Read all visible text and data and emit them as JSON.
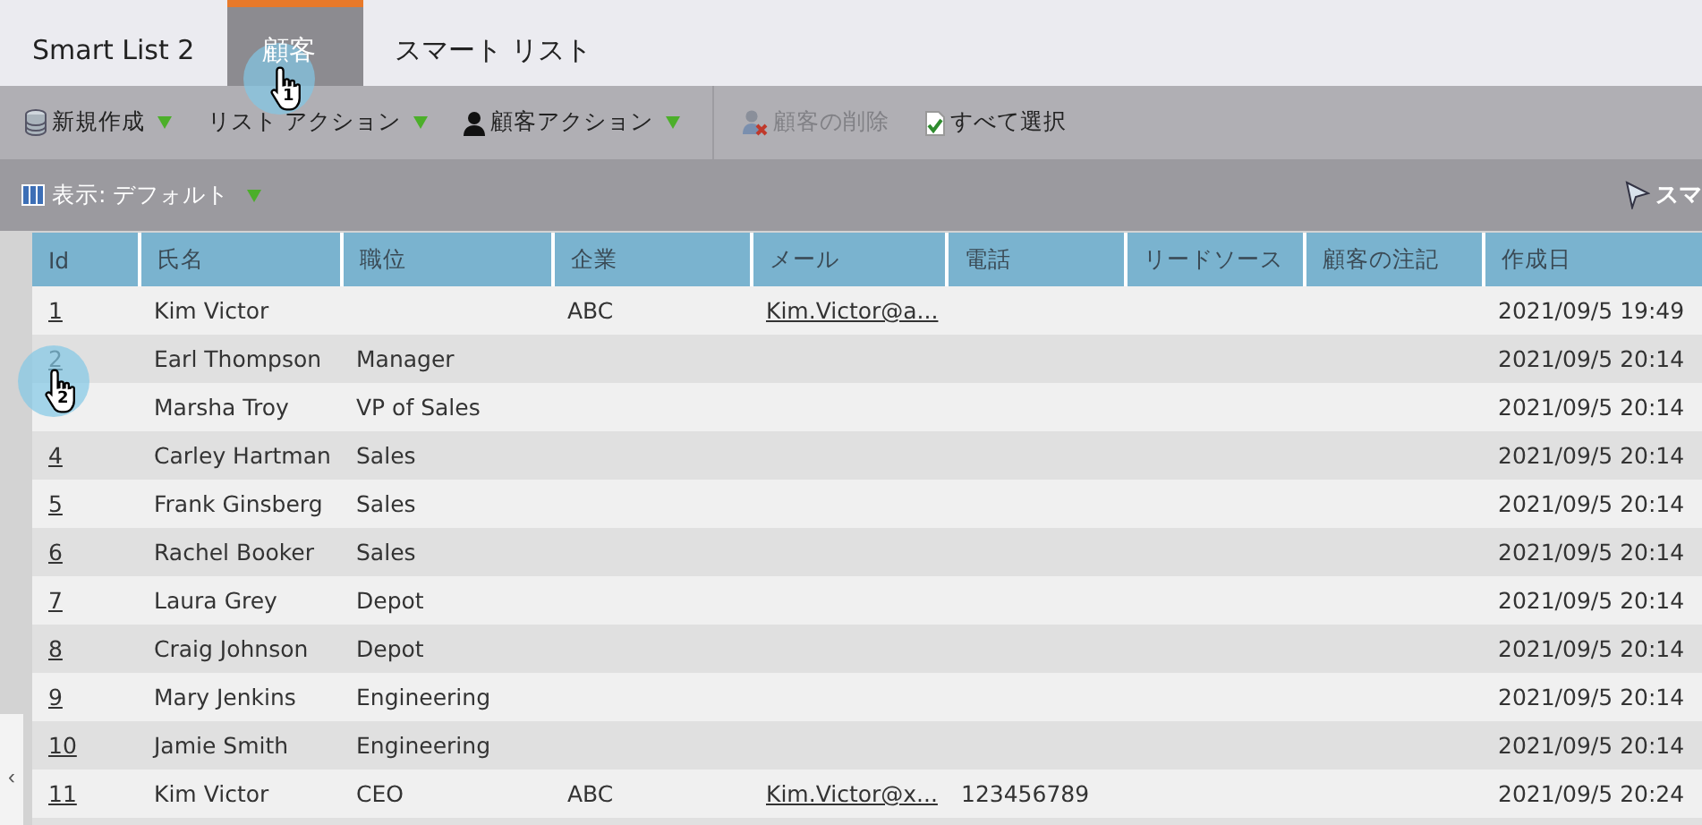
{
  "tabs": [
    {
      "label": "Smart List 2",
      "selected": false
    },
    {
      "label": "顧客",
      "selected": true,
      "click_marker": "1"
    },
    {
      "label": "スマート リスト",
      "selected": false
    }
  ],
  "toolbar": [
    {
      "kind": "database",
      "label": "新規作成",
      "menu": true,
      "disabled": false
    },
    {
      "kind": "plain",
      "label": "リスト アクション",
      "menu": true,
      "disabled": false
    },
    {
      "kind": "person",
      "label": "顧客アクション",
      "menu": true,
      "disabled": false
    },
    {
      "kind": "separator"
    },
    {
      "kind": "delete",
      "label": "顧客の削除",
      "menu": false,
      "disabled": true
    },
    {
      "kind": "select",
      "label": "すべて選択",
      "menu": false,
      "disabled": false
    }
  ],
  "view": {
    "label": "表示: デフォルト",
    "right_label": "スマ"
  },
  "table": {
    "columns": [
      "Id",
      "氏名",
      "職位",
      "企業",
      "メール",
      "電話",
      "リードソース",
      "顧客の注記",
      "作成日"
    ],
    "rows": [
      {
        "id": "1",
        "name": "Kim Victor",
        "title": "",
        "company": "ABC",
        "email": "Kim.Victor@a...",
        "phone": "",
        "created": "2021/09/5 19:49"
      },
      {
        "id": "2",
        "name": "Earl Thompson",
        "title": "Manager",
        "company": "",
        "email": "",
        "phone": "",
        "created": "2021/09/5 20:14",
        "click_marker": "2"
      },
      {
        "name": "Marsha Troy",
        "title": "VP of Sales",
        "company": "",
        "email": "",
        "phone": "",
        "created": "2021/09/5 20:14"
      },
      {
        "id": "4",
        "name": "Carley Hartman",
        "title": "Sales",
        "company": "",
        "email": "",
        "phone": "",
        "created": "2021/09/5 20:14"
      },
      {
        "id": "5",
        "name": "Frank Ginsberg",
        "title": "Sales",
        "company": "",
        "email": "",
        "phone": "",
        "created": "2021/09/5 20:14"
      },
      {
        "id": "6",
        "name": "Rachel Booker",
        "title": "Sales",
        "company": "",
        "email": "",
        "phone": "",
        "created": "2021/09/5 20:14"
      },
      {
        "id": "7",
        "name": "Laura Grey",
        "title": "Depot",
        "company": "",
        "email": "",
        "phone": "",
        "created": "2021/09/5 20:14"
      },
      {
        "id": "8",
        "name": "Craig Johnson",
        "title": "Depot",
        "company": "",
        "email": "",
        "phone": "",
        "created": "2021/09/5 20:14"
      },
      {
        "id": "9",
        "name": "Mary Jenkins",
        "title": "Engineering",
        "company": "",
        "email": "",
        "phone": "",
        "created": "2021/09/5 20:14"
      },
      {
        "id": "10",
        "name": "Jamie Smith",
        "title": "Engineering",
        "company": "",
        "email": "",
        "phone": "",
        "created": "2021/09/5 20:14"
      },
      {
        "id": "11",
        "name": "Kim Victor",
        "title": "CEO",
        "company": "ABC",
        "email": "Kim.Victor@x...",
        "phone": "123456789",
        "created": "2021/09/5 20:24"
      }
    ]
  },
  "sidebar_toggle": "‹"
}
